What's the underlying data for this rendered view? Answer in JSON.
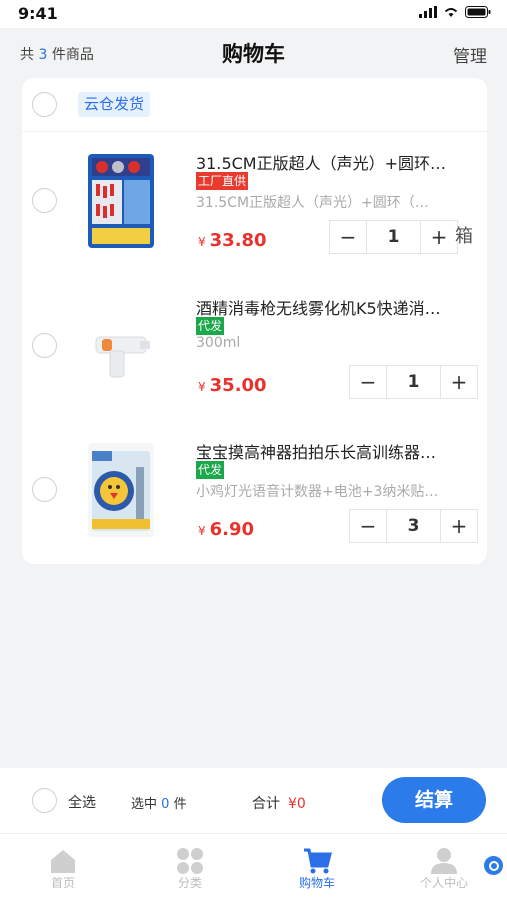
{
  "status": {
    "time": "9:41"
  },
  "header": {
    "count_prefix": "共",
    "count": "3",
    "count_suffix": "件商品",
    "title": "购物车",
    "manage": "管理"
  },
  "warehouse": {
    "label": "云仓发货"
  },
  "items": [
    {
      "name": "31.5CM正版超人（声光）+圆环…",
      "badge": "工厂直供",
      "badge_color": "#e83a2f",
      "spec": "31.5CM正版超人（声光）+圆环（…",
      "currency": "¥",
      "price": "33.80",
      "qty": "1",
      "unit": "箱"
    },
    {
      "name": "酒精消毒枪无线雾化机K5快递消…",
      "badge": "代发",
      "badge_color": "#1aa84a",
      "spec": "300ml",
      "currency": "¥",
      "price": "35.00",
      "qty": "1"
    },
    {
      "name": "宝宝摸高神器拍拍乐长高训练器…",
      "badge": "代发",
      "badge_color": "#1aa84a",
      "spec": "小鸡灯光语音计数器+电池+3纳米贴…",
      "currency": "¥",
      "price": "6.90",
      "qty": "3"
    }
  ],
  "stepper": {
    "minus": "−",
    "plus": "+"
  },
  "footer": {
    "select_all": "全选",
    "selected_prefix": "选中",
    "selected_count": "0",
    "selected_suffix": "件",
    "total_label": "合计",
    "total_amount": "¥0",
    "checkout": "结算"
  },
  "tabs": [
    {
      "label": "首页",
      "icon": "home-icon"
    },
    {
      "label": "分类",
      "icon": "category-icon"
    },
    {
      "label": "购物车",
      "icon": "cart-icon",
      "active": true
    },
    {
      "label": "个人中心",
      "icon": "profile-icon"
    }
  ],
  "colors": {
    "accent": "#2b6fe8",
    "price": "#e8322d",
    "background": "#f2f3f5"
  }
}
